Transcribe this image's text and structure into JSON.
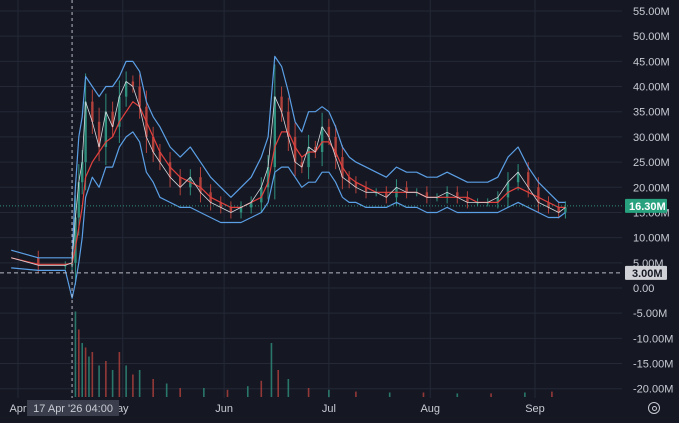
{
  "chart_data": {
    "type": "line",
    "title": "",
    "colors": {
      "background": "#151823",
      "grid": "#242837",
      "price": "#d6d7dc",
      "band": "#5b9fe6",
      "ma": "#e2413e",
      "up": "#2e8f7d",
      "down": "#b3413c",
      "price_badge": "#27a17e",
      "ref_badge": "#d0d1d6",
      "crosshair": "#b9bbc3"
    },
    "y_axis": {
      "position": "right",
      "range": [
        -22000000,
        57000000
      ],
      "tick_values": [
        55,
        50,
        45,
        40,
        35,
        30,
        25,
        20,
        15,
        10,
        5,
        0,
        -5,
        -10,
        -15,
        -20
      ],
      "tick_labels": [
        "55.00M",
        "50.00M",
        "45.00M",
        "40.00M",
        "35.00M",
        "30.00M",
        "25.00M",
        "20.00M",
        "15.00M",
        "10.00M",
        "5.00M",
        "0.00",
        "-5.00M",
        "-10.00M",
        "-15.00M",
        "-20.00M"
      ]
    },
    "x_axis": {
      "tick_labels": [
        "Apr",
        "ay",
        "Jun",
        "Jul",
        "Aug",
        "Sep"
      ],
      "tick_days": [
        0,
        31,
        61,
        92,
        122,
        153
      ]
    },
    "grid": true,
    "current_price": {
      "value": 16.3,
      "label": "16.30M"
    },
    "reference_line": {
      "value": 3.0,
      "label": "3.00M"
    },
    "crosshair": {
      "day": 16,
      "label": "17 Apr '26   04:00"
    },
    "series": [
      {
        "type": "line",
        "values_in_millions": true,
        "x_days": [
          -2,
          6,
          14,
          16,
          17,
          18,
          19,
          20,
          22,
          24,
          26,
          28,
          30,
          32,
          34,
          36,
          38,
          40,
          42,
          45,
          48,
          51,
          54,
          57,
          60,
          63,
          66,
          69,
          72,
          74,
          76,
          78,
          80,
          82,
          84,
          86,
          88,
          90,
          92,
          94,
          96,
          98,
          100,
          103,
          106,
          109,
          112,
          115,
          118,
          121,
          124,
          127,
          130,
          133,
          136,
          139,
          142,
          145,
          148,
          151,
          154,
          157,
          160,
          162
        ],
        "close": [
          6,
          4.5,
          4.5,
          5,
          14,
          21,
          25,
          37,
          33,
          28,
          35,
          32,
          38,
          41,
          40,
          36,
          30,
          27,
          25,
          22,
          20,
          22,
          19,
          17,
          16,
          15,
          16,
          17,
          20,
          24,
          38,
          35,
          30,
          25,
          24,
          28,
          27,
          32,
          30,
          26,
          22,
          21,
          20,
          19,
          19,
          18,
          20,
          19,
          19,
          18,
          18,
          19,
          18,
          17,
          17,
          17,
          18,
          21,
          23,
          20,
          17,
          16,
          15,
          16
        ],
        "ma": [
          6,
          4.7,
          4.7,
          4.9,
          8,
          12,
          16,
          22,
          25,
          27,
          29,
          30,
          33,
          35,
          37,
          36,
          33,
          30,
          27,
          24,
          22,
          21,
          20,
          18,
          17,
          16,
          16,
          17,
          18,
          21,
          28,
          31,
          31,
          28,
          26,
          27,
          27,
          29,
          29,
          27,
          24,
          22,
          21,
          20,
          19,
          19,
          19,
          19,
          19,
          18,
          18,
          18,
          18,
          18,
          17,
          17,
          17,
          19,
          20,
          19,
          18,
          17,
          16,
          16
        ],
        "upper": [
          7.5,
          6,
          6,
          6,
          20,
          30,
          34,
          42,
          40,
          38,
          40,
          40,
          42,
          45,
          45,
          43,
          37,
          34,
          32,
          28,
          26,
          28,
          25,
          22,
          20,
          18,
          20,
          22,
          26,
          30,
          46,
          44,
          39,
          33,
          31,
          35,
          35,
          36,
          35,
          32,
          28,
          26,
          25,
          24,
          23,
          22,
          24,
          23,
          23,
          22,
          22,
          23,
          22,
          21,
          21,
          21,
          22,
          26,
          28,
          24,
          21,
          19,
          17,
          17
        ],
        "lower": [
          4,
          3.5,
          3.5,
          -2,
          1,
          5,
          10,
          18,
          22,
          20,
          24,
          24,
          28,
          30,
          31,
          29,
          23,
          21,
          18,
          17,
          16,
          16,
          15,
          14,
          13,
          13,
          13,
          14,
          15,
          17,
          23,
          24,
          24,
          22,
          20,
          21,
          21,
          23,
          23,
          21,
          18,
          17,
          17,
          16,
          16,
          16,
          17,
          16,
          16,
          15,
          15,
          16,
          15,
          15,
          15,
          15,
          15,
          16,
          17,
          16,
          15,
          14,
          14,
          15
        ]
      },
      {
        "type": "bar",
        "name": "volume",
        "x_days": [
          17,
          18,
          19,
          20,
          21,
          22,
          24,
          26,
          28,
          30,
          32,
          34,
          36,
          40,
          44,
          48,
          55,
          62,
          68,
          72,
          75,
          77,
          80,
          86,
          92,
          100,
          110,
          120,
          130,
          140,
          150,
          158
        ],
        "relative_heights": [
          0.95,
          0.75,
          0.6,
          0.55,
          0.45,
          0.5,
          0.35,
          0.4,
          0.3,
          0.5,
          0.35,
          0.25,
          0.3,
          0.2,
          0.15,
          0.1,
          0.1,
          0.08,
          0.12,
          0.18,
          0.6,
          0.3,
          0.2,
          0.1,
          0.08,
          0.06,
          0.05,
          0.05,
          0.04,
          0.04,
          0.05,
          0.06
        ]
      }
    ]
  }
}
